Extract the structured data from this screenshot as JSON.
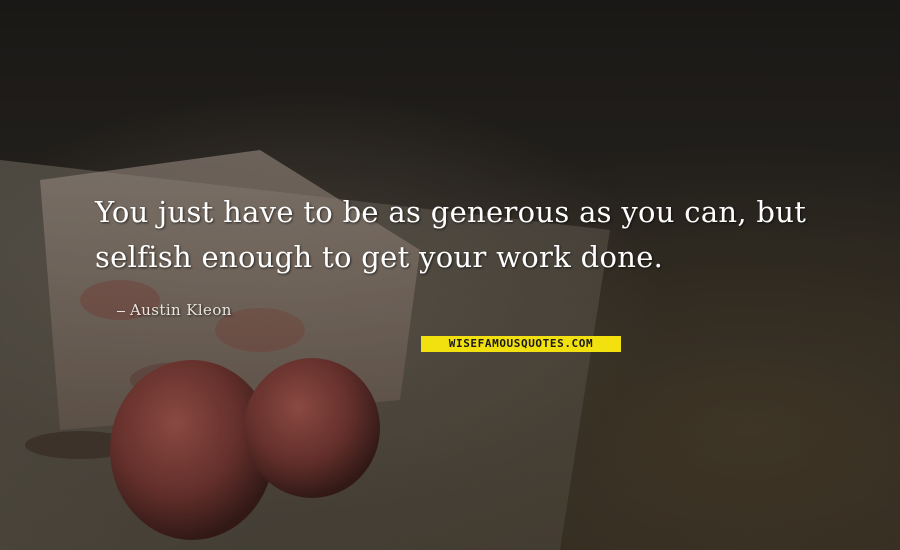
{
  "quote": {
    "line1": "You just have to be as generous as you can, but",
    "line2": "selfish enough to get your work done."
  },
  "author": "Austin Kleon",
  "watermark": "WISEFAMOUSQUOTES.COM",
  "colors": {
    "quote_text": "#ffffff",
    "watermark_bg": "#f2e10f",
    "background_dark": "#2b2620"
  }
}
